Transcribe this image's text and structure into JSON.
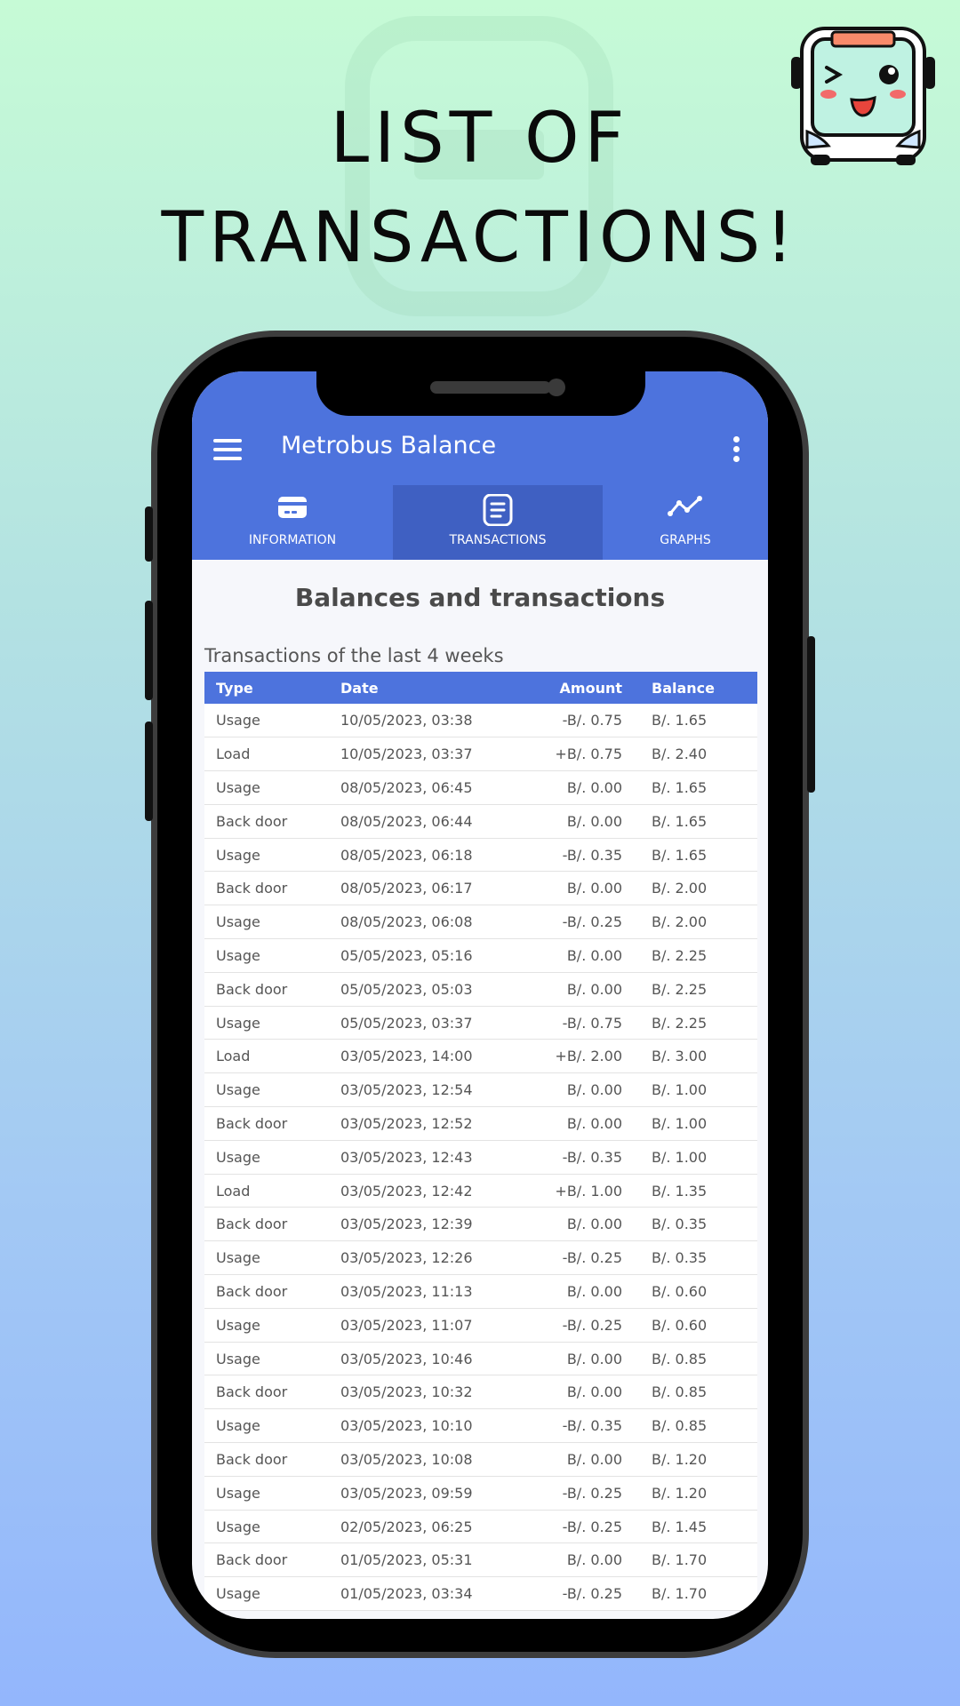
{
  "headline": {
    "line1": "LIST OF",
    "line2": "TRANSACTIONS!"
  },
  "app": {
    "title": "Metrobus Balance",
    "accent_color": "#4d73dd",
    "active_tab_color": "#3f60c2"
  },
  "tabs": [
    {
      "label": "INFORMATION",
      "icon": "card-icon"
    },
    {
      "label": "TRANSACTIONS",
      "icon": "document-icon"
    },
    {
      "label": "GRAPHS",
      "icon": "line-graph-icon"
    }
  ],
  "content": {
    "title": "Balances and transactions",
    "subtitle": "Transactions of the last 4 weeks"
  },
  "table": {
    "headers": {
      "type": "Type",
      "date": "Date",
      "amount": "Amount",
      "balance": "Balance"
    },
    "rows": [
      {
        "type": "Usage",
        "date": "10/05/2023, 03:38",
        "amount": "-B/. 0.75",
        "kind": "neg",
        "balance": "B/. 1.65"
      },
      {
        "type": "Load",
        "date": "10/05/2023, 03:37",
        "amount": "+B/. 0.75",
        "kind": "pos",
        "balance": "B/. 2.40"
      },
      {
        "type": "Usage",
        "date": "08/05/2023, 06:45",
        "amount": "B/. 0.00",
        "kind": "zero",
        "balance": "B/. 1.65"
      },
      {
        "type": "Back door",
        "date": "08/05/2023, 06:44",
        "amount": "B/. 0.00",
        "kind": "zero",
        "balance": "B/. 1.65"
      },
      {
        "type": "Usage",
        "date": "08/05/2023, 06:18",
        "amount": "-B/. 0.35",
        "kind": "neg",
        "balance": "B/. 1.65"
      },
      {
        "type": "Back door",
        "date": "08/05/2023, 06:17",
        "amount": "B/. 0.00",
        "kind": "zero",
        "balance": "B/. 2.00"
      },
      {
        "type": "Usage",
        "date": "08/05/2023, 06:08",
        "amount": "-B/. 0.25",
        "kind": "neg",
        "balance": "B/. 2.00"
      },
      {
        "type": "Usage",
        "date": "05/05/2023, 05:16",
        "amount": "B/. 0.00",
        "kind": "zero",
        "balance": "B/. 2.25"
      },
      {
        "type": "Back door",
        "date": "05/05/2023, 05:03",
        "amount": "B/. 0.00",
        "kind": "zero",
        "balance": "B/. 2.25"
      },
      {
        "type": "Usage",
        "date": "05/05/2023, 03:37",
        "amount": "-B/. 0.75",
        "kind": "neg",
        "balance": "B/. 2.25"
      },
      {
        "type": "Load",
        "date": "03/05/2023, 14:00",
        "amount": "+B/. 2.00",
        "kind": "pos",
        "balance": "B/. 3.00"
      },
      {
        "type": "Usage",
        "date": "03/05/2023, 12:54",
        "amount": "B/. 0.00",
        "kind": "zero",
        "balance": "B/. 1.00"
      },
      {
        "type": "Back door",
        "date": "03/05/2023, 12:52",
        "amount": "B/. 0.00",
        "kind": "zero",
        "balance": "B/. 1.00"
      },
      {
        "type": "Usage",
        "date": "03/05/2023, 12:43",
        "amount": "-B/. 0.35",
        "kind": "neg",
        "balance": "B/. 1.00"
      },
      {
        "type": "Load",
        "date": "03/05/2023, 12:42",
        "amount": "+B/. 1.00",
        "kind": "pos",
        "balance": "B/. 1.35"
      },
      {
        "type": "Back door",
        "date": "03/05/2023, 12:39",
        "amount": "B/. 0.00",
        "kind": "zero",
        "balance": "B/. 0.35"
      },
      {
        "type": "Usage",
        "date": "03/05/2023, 12:26",
        "amount": "-B/. 0.25",
        "kind": "neg",
        "balance": "B/. 0.35"
      },
      {
        "type": "Back door",
        "date": "03/05/2023, 11:13",
        "amount": "B/. 0.00",
        "kind": "zero",
        "balance": "B/. 0.60"
      },
      {
        "type": "Usage",
        "date": "03/05/2023, 11:07",
        "amount": "-B/. 0.25",
        "kind": "neg",
        "balance": "B/. 0.60"
      },
      {
        "type": "Usage",
        "date": "03/05/2023, 10:46",
        "amount": "B/. 0.00",
        "kind": "zero",
        "balance": "B/. 0.85"
      },
      {
        "type": "Back door",
        "date": "03/05/2023, 10:32",
        "amount": "B/. 0.00",
        "kind": "zero",
        "balance": "B/. 0.85"
      },
      {
        "type": "Usage",
        "date": "03/05/2023, 10:10",
        "amount": "-B/. 0.35",
        "kind": "neg",
        "balance": "B/. 0.85"
      },
      {
        "type": "Back door",
        "date": "03/05/2023, 10:08",
        "amount": "B/. 0.00",
        "kind": "zero",
        "balance": "B/. 1.20"
      },
      {
        "type": "Usage",
        "date": "03/05/2023, 09:59",
        "amount": "-B/. 0.25",
        "kind": "neg",
        "balance": "B/. 1.20"
      },
      {
        "type": "Usage",
        "date": "02/05/2023, 06:25",
        "amount": "-B/. 0.25",
        "kind": "neg",
        "balance": "B/. 1.45"
      },
      {
        "type": "Back door",
        "date": "01/05/2023, 05:31",
        "amount": "B/. 0.00",
        "kind": "zero",
        "balance": "B/. 1.70"
      },
      {
        "type": "Usage",
        "date": "01/05/2023, 03:34",
        "amount": "-B/. 0.25",
        "kind": "neg",
        "balance": "B/. 1.70"
      }
    ]
  },
  "colors": {
    "negative": "#e8453c",
    "positive": "#1dbf7a",
    "zero": "#f0b429"
  }
}
